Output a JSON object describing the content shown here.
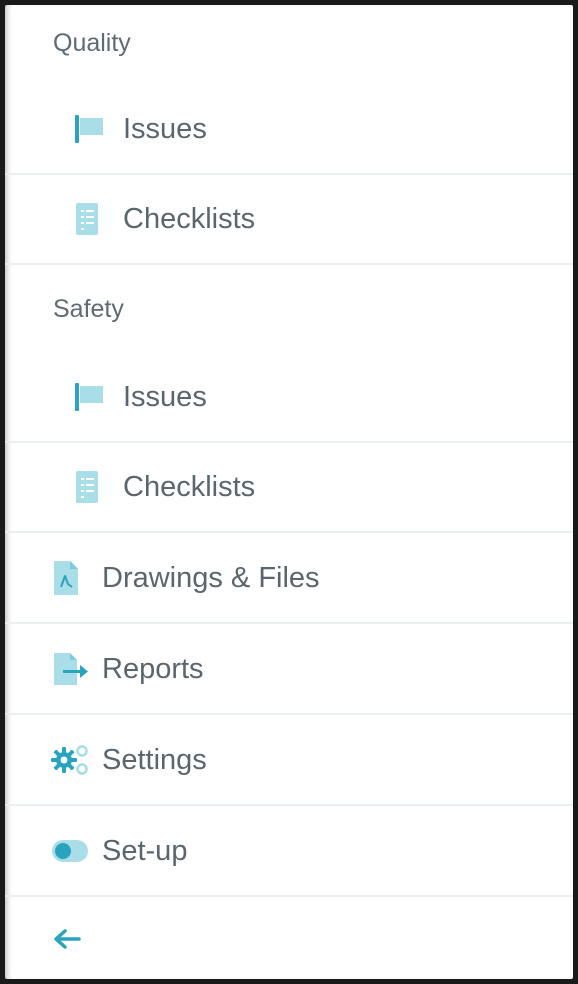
{
  "sidebar": {
    "quality": {
      "header": "Quality",
      "items": [
        {
          "label": "Issues",
          "icon": "flag-icon"
        },
        {
          "label": "Checklists",
          "icon": "checklist-icon"
        }
      ]
    },
    "safety": {
      "header": "Safety",
      "items": [
        {
          "label": "Issues",
          "icon": "flag-icon"
        },
        {
          "label": "Checklists",
          "icon": "checklist-icon"
        }
      ]
    },
    "items": [
      {
        "label": "Drawings & Files",
        "icon": "pdf-file-icon"
      },
      {
        "label": "Reports",
        "icon": "report-export-icon"
      },
      {
        "label": "Settings",
        "icon": "gears-icon"
      },
      {
        "label": "Set-up",
        "icon": "toggle-icon"
      }
    ],
    "collapse": {
      "icon": "arrow-left-icon"
    }
  },
  "colors": {
    "icon_primary": "#2aa3bf",
    "icon_light": "#a9dde8",
    "text": "#5a666e",
    "divider": "#e9eef0"
  }
}
